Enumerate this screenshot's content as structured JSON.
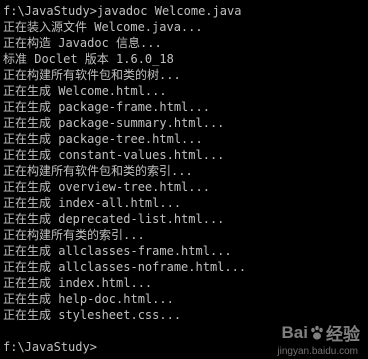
{
  "console": {
    "lines": [
      "f:\\JavaStudy>javadoc Welcome.java",
      "正在装入源文件 Welcome.java...",
      "正在构造 Javadoc 信息...",
      "标准 Doclet 版本 1.6.0_18",
      "正在构建所有软件包和类的树...",
      "正在生成 Welcome.html...",
      "正在生成 package-frame.html...",
      "正在生成 package-summary.html...",
      "正在生成 package-tree.html...",
      "正在生成 constant-values.html...",
      "正在构建所有软件包和类的索引...",
      "正在生成 overview-tree.html...",
      "正在生成 index-all.html...",
      "正在生成 deprecated-list.html...",
      "正在构建所有类的索引...",
      "正在生成 allclasses-frame.html...",
      "正在生成 allclasses-noframe.html...",
      "正在生成 index.html...",
      "正在生成 help-doc.html...",
      "正在生成 stylesheet.css...",
      "",
      "f:\\JavaStudy>"
    ],
    "cursor": "_"
  },
  "watermark": {
    "logo_left": "Bai",
    "logo_right": "经验",
    "sub": "jingyan.baidu.com",
    "paw_icon": "baidu-paw-icon"
  },
  "colors": {
    "background": "#000000",
    "text": "#c0c0c0"
  }
}
